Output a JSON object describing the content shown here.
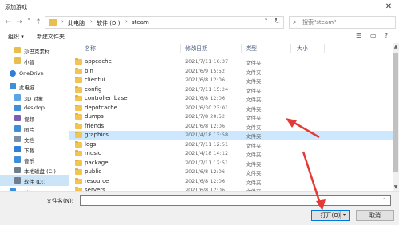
{
  "window": {
    "title": "添加游戏",
    "close_glyph": "✕"
  },
  "address": {
    "crumbs": [
      "此电脑",
      "软件 (D:)",
      "steam"
    ],
    "separators": [
      "›",
      "›",
      "›"
    ]
  },
  "search": {
    "placeholder": "搜索\"steam\""
  },
  "toolbar": {
    "organize": "组织 ▾",
    "new_folder": "新建文件夹"
  },
  "nav": {
    "items": [
      {
        "label": "沙巴克素材",
        "icon": "folder-icon",
        "color": "#e7bf4f"
      },
      {
        "label": "小智",
        "icon": "folder-icon",
        "color": "#e7bf4f"
      },
      {
        "label": "OneDrive",
        "icon": "cloud-icon",
        "color": "#2f7ed8"
      },
      {
        "label": "此电脑",
        "icon": "computer-icon",
        "color": "#3d8fd9"
      },
      {
        "label": "3D 对象",
        "icon": "cube-icon",
        "color": "#5aa5e6"
      },
      {
        "label": "desktop",
        "icon": "desktop-icon",
        "color": "#3d8fd9"
      },
      {
        "label": "视频",
        "icon": "video-icon",
        "color": "#7b5fb0"
      },
      {
        "label": "图片",
        "icon": "picture-icon",
        "color": "#3e8fd6"
      },
      {
        "label": "文档",
        "icon": "document-icon",
        "color": "#7a8fa8"
      },
      {
        "label": "下载",
        "icon": "download-icon",
        "color": "#2f7ed8"
      },
      {
        "label": "音乐",
        "icon": "music-icon",
        "color": "#3d8fd9"
      },
      {
        "label": "本地磁盘 (C:)",
        "icon": "drive-icon",
        "color": "#6f7d8c"
      },
      {
        "label": "软件 (D:)",
        "icon": "drive-icon",
        "color": "#6f7d8c"
      },
      {
        "label": "网络",
        "icon": "network-icon",
        "color": "#3d8fd9"
      }
    ]
  },
  "columns": {
    "name": "名称",
    "date": "修改日期",
    "type": "类型",
    "size": "大小"
  },
  "files": [
    {
      "name": "appcache",
      "date": "2021/7/11 16:37",
      "type": "文件夹"
    },
    {
      "name": "bin",
      "date": "2021/6/9 15:52",
      "type": "文件夹"
    },
    {
      "name": "clientui",
      "date": "2021/6/8 12:06",
      "type": "文件夹"
    },
    {
      "name": "config",
      "date": "2021/7/11 15:24",
      "type": "文件夹"
    },
    {
      "name": "controller_base",
      "date": "2021/6/8 12:06",
      "type": "文件夹"
    },
    {
      "name": "depotcache",
      "date": "2021/6/30 23:01",
      "type": "文件夹"
    },
    {
      "name": "dumps",
      "date": "2021/7/8 20:52",
      "type": "文件夹"
    },
    {
      "name": "friends",
      "date": "2021/6/8 12:06",
      "type": "文件夹"
    },
    {
      "name": "graphics",
      "date": "2021/4/18 13:58",
      "type": "文件夹"
    },
    {
      "name": "logs",
      "date": "2021/7/11 12:51",
      "type": "文件夹"
    },
    {
      "name": "music",
      "date": "2021/4/18 14:12",
      "type": "文件夹"
    },
    {
      "name": "package",
      "date": "2021/7/11 12:51",
      "type": "文件夹"
    },
    {
      "name": "public",
      "date": "2021/6/8 12:06",
      "type": "文件夹"
    },
    {
      "name": "resource",
      "date": "2021/6/8 12:06",
      "type": "文件夹"
    },
    {
      "name": "servers",
      "date": "2021/6/8 12:06",
      "type": "文件夹"
    }
  ],
  "bottom": {
    "filename_label": "文件名(N):",
    "filename_value": "",
    "open_label": "打开(O)",
    "cancel_label": "取消"
  },
  "colors": {
    "accent": "#0078d7",
    "selection": "#cce8ff",
    "annotation": "#e53935"
  }
}
